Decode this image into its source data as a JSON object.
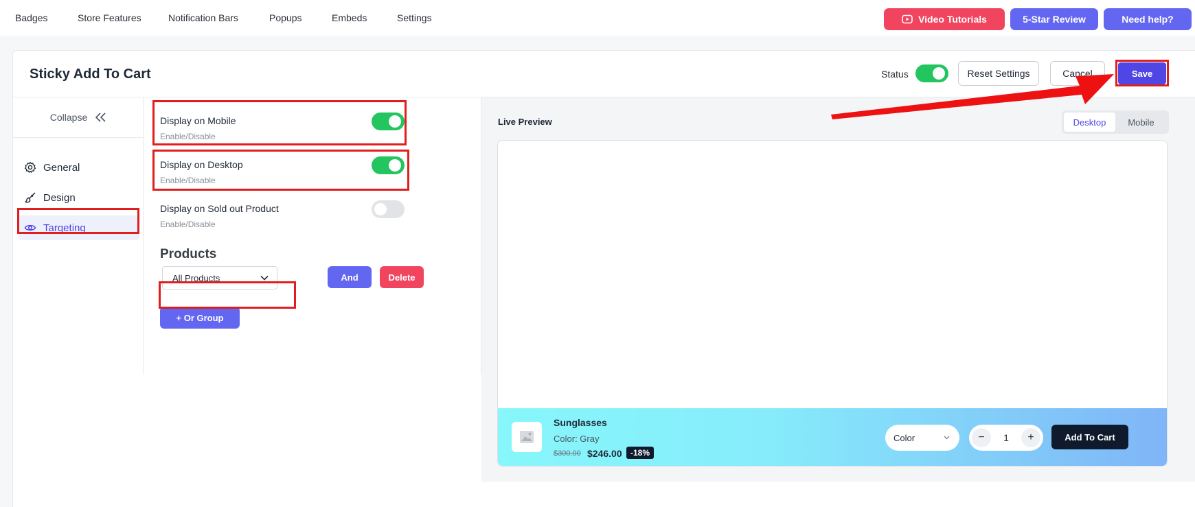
{
  "topnav": {
    "links": [
      "Badges",
      "Store Features",
      "Notification Bars",
      "Popups",
      "Embeds",
      "Settings"
    ],
    "video_label": "Video Tutorials",
    "review_label": "5-Star Review",
    "help_label": "Need help?"
  },
  "header": {
    "title": "Sticky Add To Cart",
    "status_label": "Status",
    "status_on": true,
    "reset_label": "Reset Settings",
    "cancel_label": "Cancel",
    "save_label": "Save"
  },
  "sidebar": {
    "collapse_label": "Collapse",
    "items": [
      {
        "label": "General",
        "icon": "gear-icon"
      },
      {
        "label": "Design",
        "icon": "brush-icon"
      },
      {
        "label": "Targeting",
        "icon": "eye-icon",
        "active": true
      }
    ]
  },
  "settings": {
    "mobile": {
      "label": "Display on Mobile",
      "sub": "Enable/Disable",
      "on": true
    },
    "desktop": {
      "label": "Display on Desktop",
      "sub": "Enable/Disable",
      "on": true
    },
    "soldout": {
      "label": "Display on Sold out Product",
      "sub": "Enable/Disable",
      "on": false
    },
    "products_heading": "Products",
    "select_value": "All Products",
    "and_label": "And",
    "delete_label": "Delete",
    "or_group_label": "+ Or Group"
  },
  "preview": {
    "label": "Live Preview",
    "tabs": [
      "Desktop",
      "Mobile"
    ],
    "active_tab": "Desktop",
    "product_name": "Sunglasses",
    "variant": "Color: Gray",
    "price_old": "$300.00",
    "price_new": "$246.00",
    "discount": "-18%",
    "color_select": "Color",
    "quantity": "1",
    "add_to_cart": "Add To Cart"
  },
  "colors": {
    "accent": "#6366f1",
    "danger": "#f1445e",
    "toggle_on": "#22c55e",
    "highlight": "#e11d1d"
  }
}
